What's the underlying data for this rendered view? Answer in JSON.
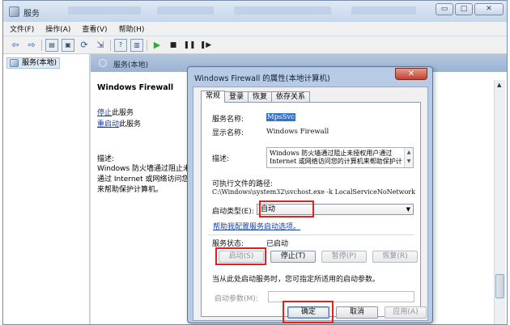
{
  "window": {
    "title": "服务",
    "buttons": {
      "minimize": "▭",
      "maximize": "□",
      "close": "✕"
    }
  },
  "menubar": [
    "文件(F)",
    "操作(A)",
    "查看(V)",
    "帮助(H)"
  ],
  "tree": {
    "item": "服务(本地)"
  },
  "right_header": "服务(本地)",
  "detail": {
    "title": "Windows Firewall",
    "stop_link": "停止",
    "stop_rest": "此服务",
    "restart_link": "重启动",
    "restart_rest": "此服务",
    "desc_label": "描述:",
    "desc_lines": [
      "Windows 防火墙通过阻止未授",
      "通过 Internet 或网络访问您的",
      "来帮助保护计算机。"
    ]
  },
  "dialog": {
    "title": "Windows Firewall 的属性(本地计算机)",
    "close": "✕",
    "tabs": [
      "常规",
      "登录",
      "恢复",
      "依存关系"
    ],
    "service_name_label": "服务名称:",
    "service_name_value": "MpsSvc",
    "display_name_label": "显示名称:",
    "display_name_value": "Windows Firewall",
    "description_label": "描述:",
    "description_lines": [
      "Windows 防火墙通过阻止未授权用户通过",
      "Internet 或网络访问您的计算机来帮助保护计"
    ],
    "exe_path_label": "可执行文件的路径:",
    "exe_path_value": "C:\\Windows\\system32\\svchost.exe -k LocalServiceNoNetwork",
    "startup_type_label": "启动类型(E):",
    "startup_type_value": "自动",
    "help_link": "帮助我配置服务启动选项。",
    "status_label": "服务状态:",
    "status_value": "已启动",
    "btn_start": "启动(S)",
    "btn_stop": "停止(T)",
    "btn_pause": "暂停(P)",
    "btn_resume": "恢复(R)",
    "hint_text": "当从此处启动服务时，您可指定所适用的启动参数。",
    "params_label": "启动参数(M):",
    "btn_ok": "确定",
    "btn_cancel": "取消",
    "btn_apply": "应用(A)"
  },
  "colors": {
    "highlight_red": "#e3201b",
    "link_blue": "#1a40a8",
    "selection_blue": "#3374c9"
  }
}
